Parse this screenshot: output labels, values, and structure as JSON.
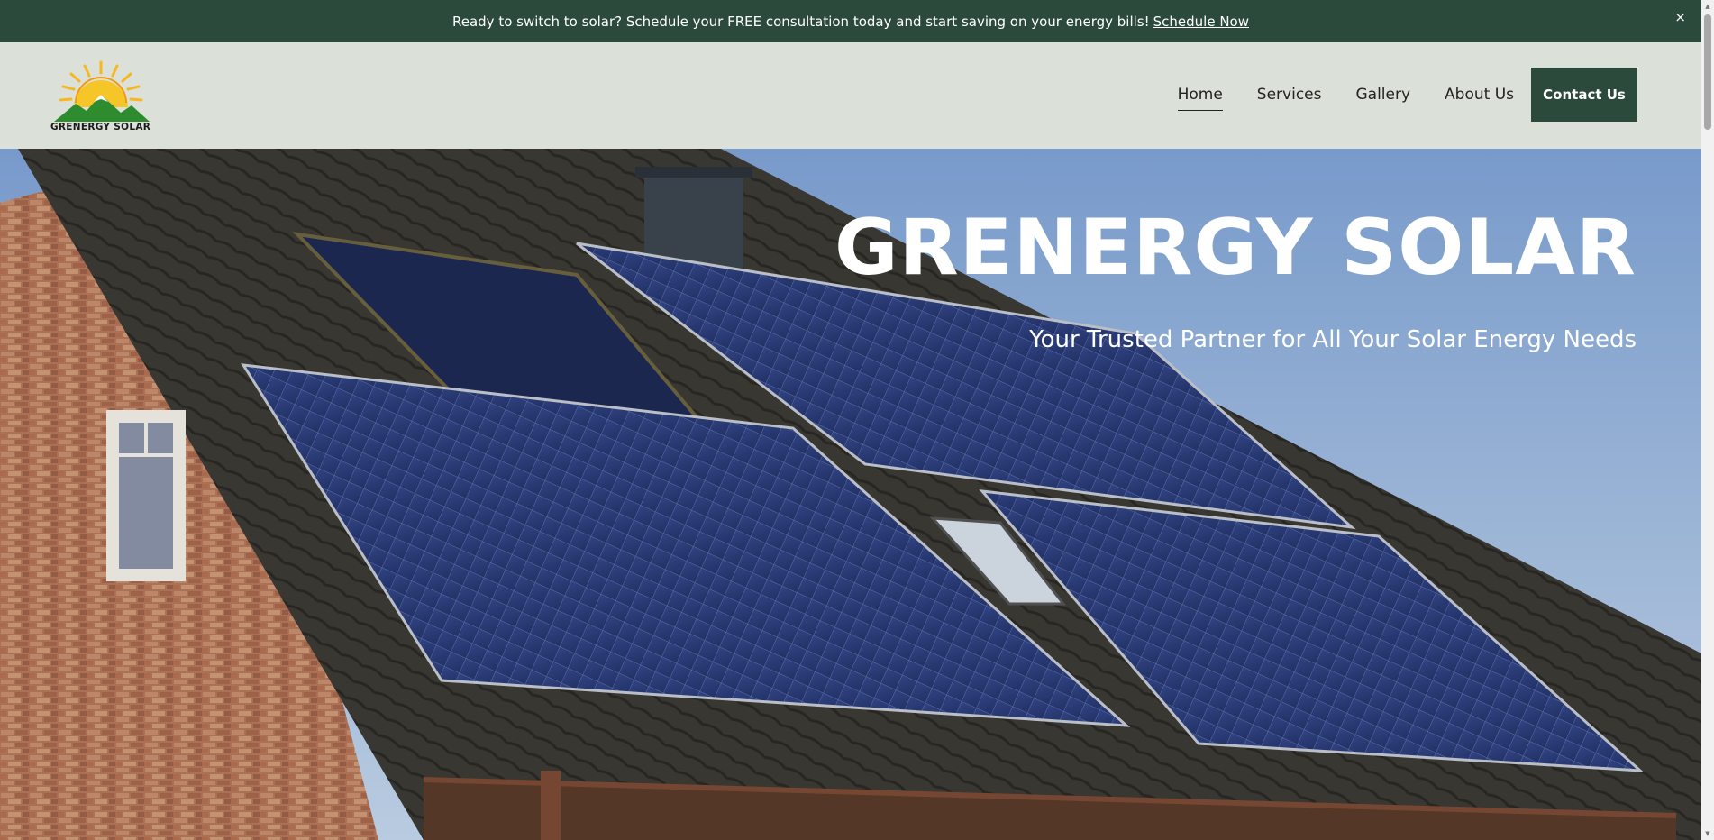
{
  "announcement": {
    "text": "Ready to switch to solar? Schedule your FREE consultation today and start saving on your energy bills!",
    "link_label": "Schedule Now",
    "close_label": "×"
  },
  "header": {
    "logo_text": "GRENERGY SOLAR",
    "nav": [
      {
        "label": "Home",
        "active": true
      },
      {
        "label": "Services",
        "active": false
      },
      {
        "label": "Gallery",
        "active": false
      },
      {
        "label": "About Us",
        "active": false
      }
    ],
    "cta_label": "Contact Us"
  },
  "hero": {
    "title": "GRENERGY SOLAR",
    "subtitle": "Your Trusted Partner for All Your Solar Energy Needs"
  },
  "colors": {
    "brand_dark": "#2b4a3c",
    "header_bg": "#dbe1d8",
    "sun": "#f5b820",
    "mountain": "#2e8b2e"
  }
}
